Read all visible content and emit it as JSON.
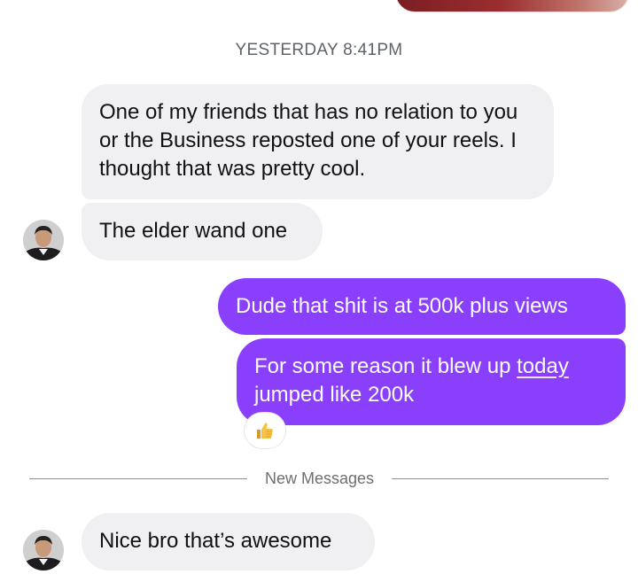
{
  "conversation": {
    "timestamp": "YESTERDAY 8:41PM",
    "messages": [
      {
        "sender": "them",
        "text": "One of my friends that has no relation to you or the Business reposted one of your reels. I thought that was pretty cool."
      },
      {
        "sender": "them",
        "text": "The elder wand one"
      },
      {
        "sender": "me",
        "text": "Dude that shit is at 500k plus views"
      },
      {
        "sender": "me",
        "text_before_link": "For some reason it blew up ",
        "link_text": "today",
        "text_after_link": " jumped like 200k",
        "reaction": "thumbs-up-icon"
      },
      {
        "sender": "them",
        "text": "Nice bro that’s awesome"
      }
    ],
    "new_messages_label": "New Messages"
  },
  "colors": {
    "outgoing_bubble": "#8a3ffc",
    "incoming_bubble": "#f0f0f2",
    "timestamp_text": "#5f6368"
  }
}
